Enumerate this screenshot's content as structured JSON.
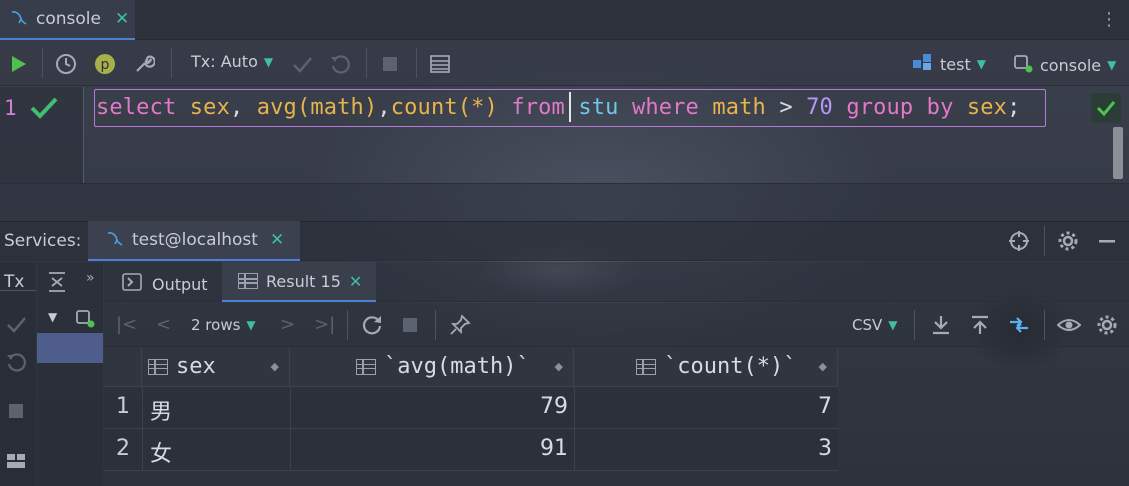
{
  "editor_tab": {
    "label": "console",
    "close": "✕"
  },
  "toolbar": {
    "tx_label": "Tx: Auto",
    "datasource": "test",
    "session": "console"
  },
  "editor": {
    "line_number": "1",
    "sql_tokens": [
      {
        "t": "select",
        "c": "kw"
      },
      {
        "t": " ",
        "c": "op"
      },
      {
        "t": "sex",
        "c": "id"
      },
      {
        "t": ", ",
        "c": "op"
      },
      {
        "t": "avg",
        "c": "id"
      },
      {
        "t": "(",
        "c": "id"
      },
      {
        "t": "math",
        "c": "id"
      },
      {
        "t": ")",
        "c": "id"
      },
      {
        "t": ",",
        "c": "op"
      },
      {
        "t": "count",
        "c": "id"
      },
      {
        "t": "(*)",
        "c": "id"
      },
      {
        "t": " ",
        "c": "op"
      },
      {
        "t": "from",
        "c": "kw"
      },
      {
        "t": " ",
        "c": "op"
      },
      {
        "t": "stu",
        "c": "tbl"
      },
      {
        "t": " ",
        "c": "op"
      },
      {
        "t": "where",
        "c": "kw"
      },
      {
        "t": " ",
        "c": "op"
      },
      {
        "t": "math",
        "c": "id"
      },
      {
        "t": " > ",
        "c": "op"
      },
      {
        "t": "70",
        "c": "num"
      },
      {
        "t": " ",
        "c": "op"
      },
      {
        "t": "group by",
        "c": "kw"
      },
      {
        "t": " ",
        "c": "op"
      },
      {
        "t": "sex",
        "c": "id"
      },
      {
        "t": ";",
        "c": "op"
      }
    ]
  },
  "services": {
    "label": "Services:",
    "tab": "test@localhost",
    "tx_side": "Tx"
  },
  "results": {
    "output_tab": "Output",
    "result_tab": "Result 15",
    "rows_label": "2 rows",
    "export_format": "CSV",
    "columns": [
      "sex",
      "`avg(math)`",
      "`count(*)`"
    ],
    "rows": [
      {
        "num": "1",
        "sex": "男",
        "avg": "79",
        "count": "7"
      },
      {
        "num": "2",
        "sex": "女",
        "avg": "91",
        "count": "3"
      }
    ]
  },
  "colors": {
    "accent_green": "#3fbf9f",
    "run_green": "#4ec24e",
    "keyword": "#e378c8",
    "identifier": "#e8b34d",
    "table": "#6fc8e8",
    "number": "#b695f4"
  },
  "icons": [
    "mysql-icon",
    "run-icon",
    "history-icon",
    "profile-icon",
    "wrench-icon",
    "commit-icon",
    "rollback-icon",
    "stop-icon",
    "table-layout-icon",
    "datasource-icon",
    "session-icon",
    "check-icon",
    "target-icon",
    "gear-icon",
    "minimize-icon",
    "collapse-icon",
    "more-icon",
    "table-icon",
    "console-icon",
    "reload-icon",
    "pin-icon",
    "download-icon",
    "upload-icon",
    "compare-icon",
    "eye-icon",
    "sort-icon"
  ]
}
